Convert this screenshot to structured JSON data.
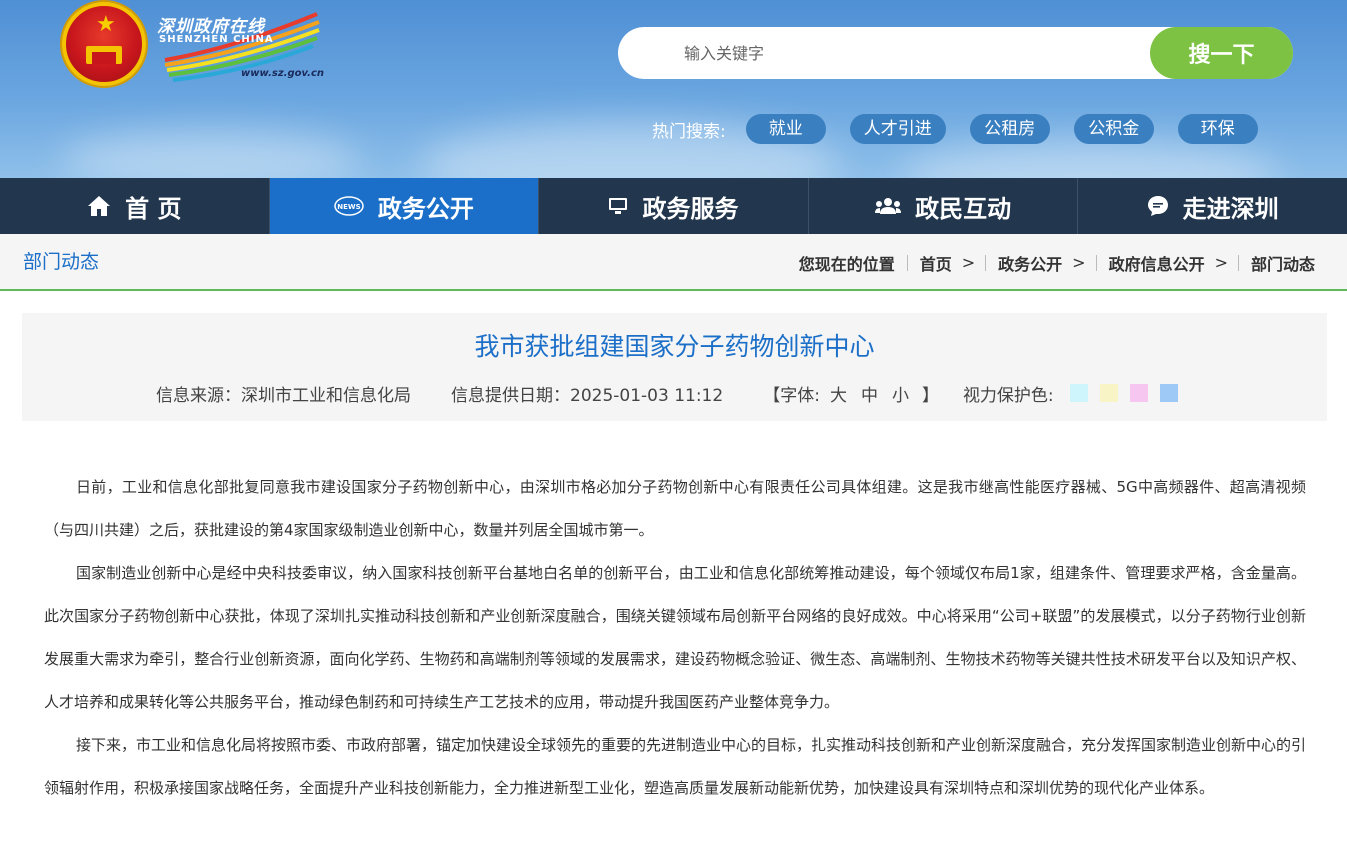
{
  "header": {
    "logo": {
      "cn": "深圳政府在线",
      "en": "SHENZHEN  CHINA",
      "url": "www.sz.gov.cn"
    },
    "search": {
      "placeholder": "输入关键字",
      "button": "搜一下"
    },
    "hot": {
      "label": "热门搜索:",
      "tags": [
        "就业",
        "人才引进",
        "公租房",
        "公积金",
        "环保"
      ]
    }
  },
  "nav": {
    "items": [
      {
        "label": "首 页",
        "icon": "home-icon"
      },
      {
        "label": "政务公开",
        "icon": "news-icon"
      },
      {
        "label": "政务服务",
        "icon": "monitor-icon"
      },
      {
        "label": "政民互动",
        "icon": "people-icon"
      },
      {
        "label": "走进深圳",
        "icon": "chat-bubble-icon"
      }
    ],
    "active_index": 1
  },
  "breadcrumb": {
    "section": "部门动态",
    "label": "您现在的位置",
    "items": [
      "首页",
      "政务公开",
      "政府信息公开",
      "部门动态"
    ],
    "separator": ">"
  },
  "article": {
    "title": "我市获批组建国家分子药物创新中心",
    "source": "信息来源：深圳市工业和信息化局",
    "date": "信息提供日期：2025-01-03 11:12",
    "font_label": "【字体:",
    "font_sizes": [
      "大",
      "中",
      "小"
    ],
    "font_close": "】",
    "eye_label": "视力保护色:",
    "eye_colors": [
      "#cdf5fb",
      "#f8f4c6",
      "#f7c6f0",
      "#9ec8f5"
    ],
    "paragraphs": [
      "日前，工业和信息化部批复同意我市建设国家分子药物创新中心，由深圳市格必加分子药物创新中心有限责任公司具体组建。这是我市继高性能医疗器械、5G中高频器件、超高清视频（与四川共建）之后，获批建设的第4家国家级制造业创新中心，数量并列居全国城市第一。",
      "国家制造业创新中心是经中央科技委审议，纳入国家科技创新平台基地白名单的创新平台，由工业和信息化部统筹推动建设，每个领域仅布局1家，组建条件、管理要求严格，含金量高。此次国家分子药物创新中心获批，体现了深圳扎实推动科技创新和产业创新深度融合，围绕关键领域布局创新平台网络的良好成效。中心将采用“公司+联盟”的发展模式，以分子药物行业创新发展重大需求为牵引，整合行业创新资源，面向化学药、生物药和高端制剂等领域的发展需求，建设药物概念验证、微生态、高端制剂、生物技术药物等关键共性技术研发平台以及知识产权、人才培养和成果转化等公共服务平台，推动绿色制药和可持续生产工艺技术的应用，带动提升我国医药产业整体竞争力。",
      "接下来，市工业和信息化局将按照市委、市政府部署，锚定加快建设全球领先的重要的先进制造业中心的目标，扎实推动科技创新和产业创新深度融合，充分发挥国家制造业创新中心的引领辐射作用，积极承接国家战略任务，全面提升产业科技创新能力，全力推进新型工业化，塑造高质量发展新动能新优势，加快建设具有深圳特点和深圳优势的现代化产业体系。"
    ]
  },
  "colors": {
    "nav_bg": "#22364d",
    "nav_active": "#1b6fc8",
    "search_button": "#7dc242",
    "title": "#1b6fc8",
    "accent_line": "#5fb85a"
  }
}
